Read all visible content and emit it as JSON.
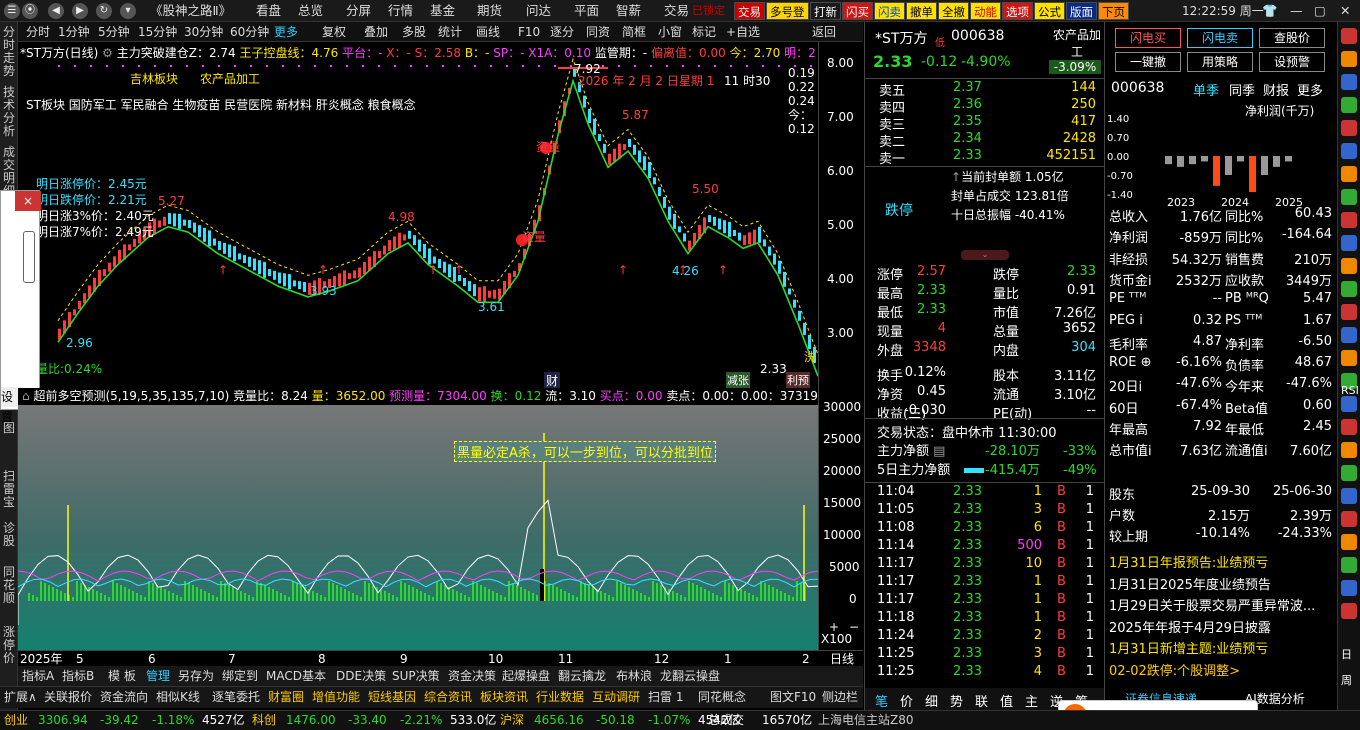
{
  "topbar": {
    "title": "《股神之路Ⅱ》",
    "menus": [
      "看盘",
      "总览",
      "分屏",
      "行情",
      "基金",
      "期货",
      "问达",
      "平面",
      "智薪"
    ],
    "trade": "交易",
    "tag": "已锁定",
    "buttons": [
      {
        "label": "交易",
        "bg": "#cc0000",
        "fg": "#fff"
      },
      {
        "label": "多号登",
        "bg": "#ffd400",
        "fg": "#000"
      },
      {
        "label": "打新",
        "bg": "#1a1a1a",
        "fg": "#fff"
      },
      {
        "label": "闪买",
        "bg": "#d01515",
        "fg": "#fff"
      },
      {
        "label": "闪卖",
        "bg": "#ffe100",
        "fg": "#0044cc"
      },
      {
        "label": "撤单",
        "bg": "#ffe100",
        "fg": "#000"
      },
      {
        "label": "全撤",
        "bg": "#ffe100",
        "fg": "#000"
      },
      {
        "label": "动能",
        "bg": "#ffe100",
        "fg": "#c00"
      },
      {
        "label": "选项",
        "bg": "#d01515",
        "fg": "#fff"
      },
      {
        "label": "公式",
        "bg": "#ffe100",
        "fg": "#000"
      },
      {
        "label": "版面",
        "bg": "#0a2a8a",
        "fg": "#fff"
      },
      {
        "label": "下页",
        "bg": "#ff8a00",
        "fg": "#000"
      }
    ],
    "clock": "12:22:59 周一"
  },
  "leftbar": [
    "分时走势",
    "技术分析",
    "成交明细",
    "图",
    "扫雷宝",
    "诊股",
    "同花顺",
    "涨停价"
  ],
  "popup": {
    "close": "×",
    "button": "设置"
  },
  "toolbar": {
    "items": [
      "分时",
      "1分钟",
      "5分钟",
      "15分钟",
      "30分钟",
      "60分钟",
      "更多",
      "复权",
      "叠加",
      "多股",
      "统计",
      "画线",
      "F10",
      "逐分",
      "同资",
      "简框",
      "小窗",
      "标记",
      "+自选",
      "返回"
    ]
  },
  "chart": {
    "header": {
      "name": "*ST万方(日线)",
      "ind1": "主力突破建仓Z：2.74",
      "ind2": "王子控盘线：4.76",
      "ind3": "平台：-",
      "x": "X：-",
      "s": "S：2.58",
      "b": "B：-",
      "sp": "SP：-",
      "x1a": "X1A：0.10",
      "jg": "监管期：-",
      "ply": "偏离值：0.00",
      "jin": "今：2.70",
      "ming": "明：2"
    },
    "tags": [
      "吉林板块",
      "农产品加工"
    ],
    "concepts": "ST板块 国防军工 军民融合 生物疫苗 民营医院 新材料 肝炎概念 粮食概念",
    "info": [
      "明日涨停价：2.45元",
      "明日跌停价：2.21元",
      "明日涨3%价：2.40元",
      "明日涨7%价：2.49元"
    ],
    "date": "2026 年 2 月 2 日星期 1",
    "time": "11 时30",
    "legend": [
      "0.19",
      "0.22",
      "0.24",
      "今：0.12"
    ],
    "peaks": [
      "7.92",
      "5.87",
      "5.50",
      "5.27",
      "4.98",
      "3.93",
      "3.61",
      "2.96",
      "4.26",
      "2.33"
    ],
    "marks": [
      "资量",
      "资量",
      "洗",
      "财",
      "减张",
      "利预",
      "量比:0.24%"
    ],
    "yaxis": [
      "8.00",
      "7.00",
      "6.00",
      "5.00",
      "4.00",
      "3.00"
    ]
  },
  "volbar": {
    "label": "超前多空预测(5,19,5,35,135,7,10)",
    "jlb": "竞量比：8.24",
    "liang": "量：3652.00",
    "ycl": "预测量：7304.00",
    "huan": "换：0.12",
    "liu": "流：3.10",
    "maid": "买点：0.00",
    "maid2": "卖点：0.00：0.00：373193.81"
  },
  "subchart": {
    "note": "黑量必定A杀，可以一步到位，可以分批到位",
    "yaxis": [
      "30000",
      "25000",
      "20000",
      "15000",
      "10000",
      "5000",
      "0"
    ],
    "unit": "X100"
  },
  "xaxis": {
    "labels": [
      "2025年",
      "5",
      "6",
      "7",
      "8",
      "9",
      "10",
      "11",
      "12",
      "1",
      "2"
    ],
    "right": "日线"
  },
  "tabs1": [
    "指标A",
    "指标B",
    "模 板",
    "管理",
    "另存为",
    "绑定到",
    "MACD基本",
    "DDE决策",
    "SUP决策",
    "资金决策",
    "起爆操盘",
    "翻云擒龙",
    "布林浪",
    "龙翻云操盘"
  ],
  "tabs2": [
    "扩展∧",
    "关联报价",
    "资金流向",
    "相似K线",
    "逐笔委托",
    "财富圈",
    "增值功能",
    "短线基因",
    "综合资讯",
    "板块资讯",
    "行业数据",
    "互动调研",
    "扫雷 1",
    "同花概念",
    "图文F10",
    "侧边栏"
  ],
  "quote": {
    "name": "*ST万方",
    "code": "000638",
    "price": "2.33",
    "chg": "-0.12",
    "pct": "-4.90%",
    "industry": "农产品加工",
    "ind_pct": "-3.09%",
    "btns": [
      "闪电买",
      "闪电卖",
      "查股价",
      "一键撤",
      "用策略",
      "设预警"
    ],
    "asks": [
      [
        "卖五",
        "2.37",
        "144"
      ],
      [
        "卖四",
        "2.36",
        "250"
      ],
      [
        "卖三",
        "2.35",
        "417"
      ],
      [
        "卖二",
        "2.34",
        "2428"
      ],
      [
        "卖一",
        "2.33",
        "452151"
      ]
    ],
    "dt": "跌停",
    "fd": [
      "当前封单额 1.05亿",
      "封单占成交 123.81倍",
      "十日总振幅 -40.41%"
    ],
    "stats": [
      [
        "涨停",
        "2.57",
        "跌停",
        "2.33"
      ],
      [
        "最高",
        "2.33",
        "量比",
        "0.91"
      ],
      [
        "最低",
        "2.33",
        "市值",
        "7.26亿"
      ],
      [
        "现量",
        "4",
        "总量",
        "3652"
      ],
      [
        "外盘",
        "3348",
        "内盘",
        "304"
      ],
      [
        "换手",
        "0.12%",
        "股本",
        "3.11亿"
      ],
      [
        "净资",
        "0.45",
        "流通",
        "3.10亿"
      ],
      [
        "收益(三)",
        "-0.030",
        "PE(动)",
        "--"
      ]
    ],
    "state": "交易状态：盘中休市 11:30:00",
    "flow": [
      [
        "主力净额",
        "-28.10万",
        "-33%"
      ],
      [
        "5日主力净额",
        "-415.4万",
        "-49%"
      ]
    ],
    "ticks": [
      [
        "11:04",
        "2.33",
        "1",
        "B",
        "1"
      ],
      [
        "11:05",
        "2.33",
        "3",
        "B",
        "1"
      ],
      [
        "11:08",
        "2.33",
        "6",
        "B",
        "1"
      ],
      [
        "11:14",
        "2.33",
        "500",
        "B",
        "1"
      ],
      [
        "11:17",
        "2.33",
        "10",
        "B",
        "1"
      ],
      [
        "11:17",
        "2.33",
        "1",
        "B",
        "1"
      ],
      [
        "11:17",
        "2.33",
        "1",
        "B",
        "1"
      ],
      [
        "11:18",
        "2.33",
        "1",
        "B",
        "1"
      ],
      [
        "11:24",
        "2.33",
        "2",
        "B",
        "1"
      ],
      [
        "11:25",
        "2.33",
        "3",
        "B",
        "1"
      ],
      [
        "11:25",
        "2.33",
        "4",
        "B",
        "1"
      ]
    ],
    "bottomtabs": [
      "笔",
      "价",
      "细",
      "势",
      "联",
      "值",
      "主",
      "逆",
      "筹"
    ]
  },
  "fin": {
    "code": "000638",
    "tabs": [
      "单季",
      "同季",
      "财报",
      "更多"
    ],
    "chart": {
      "type": "bar",
      "title": "净利润(千万)",
      "categories": [
        "2023",
        "2024",
        "2025"
      ],
      "series": [
        {
          "values": [
            -0.3,
            -0.4,
            -0.3,
            -0.2,
            -1.1,
            -0.7,
            -0.2,
            -1.33,
            -0.7,
            -0.4,
            -0.2
          ]
        }
      ],
      "yaxis": [
        "1.40",
        "0.70",
        "0.00",
        "-0.70",
        "-1.40"
      ]
    },
    "rows": [
      [
        "总收入",
        "1.76亿",
        "同比%",
        "60.43"
      ],
      [
        "净利润",
        "-859万",
        "同比%",
        "-164.64"
      ],
      [
        "非经损",
        "54.32万",
        "销售费",
        "210万"
      ],
      [
        "货币金i",
        "2532万",
        "应收款",
        "3449万"
      ],
      [
        "PE ᵀᵀᴹ",
        "--",
        "PB ᴹᴿQ",
        "5.47"
      ],
      [
        "PEG i",
        "0.32",
        "PS ᵀᵀᴹ",
        "1.67"
      ],
      [
        "毛利率",
        "4.87",
        "净利率",
        "-6.50"
      ],
      [
        "ROE ⊕",
        "-6.16%",
        "负债率",
        "48.67"
      ],
      [
        "20日i",
        "-47.6%",
        "今年来",
        "-47.6%"
      ],
      [
        "60日",
        "-67.4%",
        "Beta值",
        "0.60"
      ],
      [
        "年最高",
        "7.92",
        "年最低",
        "2.45"
      ],
      [
        "总市值i",
        "7.63亿",
        "流通值i",
        "7.60亿"
      ]
    ],
    "holders": [
      [
        "股东",
        "25-09-30",
        "25-06-30"
      ],
      [
        "户数",
        "2.15万",
        "2.39万"
      ],
      [
        "较上期",
        "-10.14%",
        "-24.33%"
      ]
    ],
    "news": [
      "1月31日年报预告:业绩预亏",
      "1月31日2025年度业绩预告",
      "1月29日关于股票交易严重异常波...",
      "2025年年报于4月29日披露",
      "1月31日新增主题:业绩预亏",
      "02-02跌停:个股调整>"
    ],
    "bottom": [
      "证券信息速递",
      "AI数据分析"
    ]
  },
  "status": {
    "items": [
      [
        "创业",
        "3306.94",
        "-39.42",
        "-1.18%",
        "4527亿"
      ],
      [
        "科创",
        "1476.00",
        "-33.40",
        "-2.21%",
        "533.0亿"
      ],
      [
        "沪深",
        "4656.16",
        "-50.18",
        "-1.07%",
        "4542亿"
      ]
    ],
    "zcj": "总成交",
    "zcjv": "16570亿",
    "site": "上海电信主站Z80"
  },
  "rightbar": [
    "RSI",
    "日",
    "周"
  ]
}
